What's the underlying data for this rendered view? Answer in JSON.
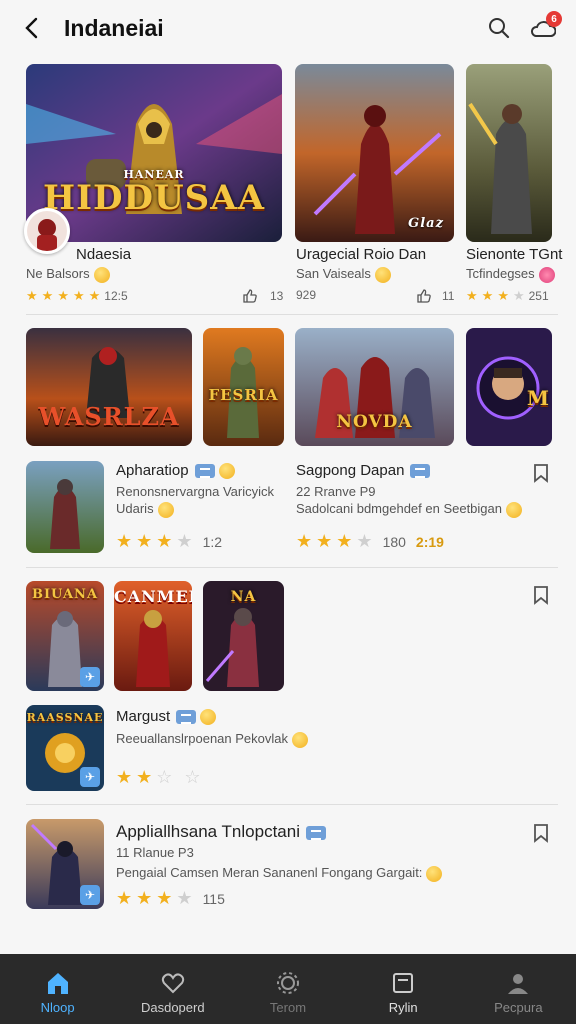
{
  "header": {
    "title": "Indaneiai",
    "notification_count": "6"
  },
  "row1": [
    {
      "art_title": "HIDDUSAA",
      "art_kicker": "HANEAR",
      "name": "Ndaesia",
      "sub": "Ne Balsors",
      "rating": 5,
      "score": "12:5",
      "likes": "13"
    },
    {
      "art_title": "Glaz",
      "name": "Uragecial Roio Dan",
      "sub": "San Vaiseals",
      "score": "929",
      "likes": "11"
    },
    {
      "name": "Sienonte TGnt",
      "sub": "Tcfindegses",
      "rating": 3,
      "score": "251"
    }
  ],
  "row2_tiles": [
    {
      "art_title": "WASRLZA"
    },
    {
      "art_title": "FESRIA"
    },
    {
      "art_title": "NOVDA"
    },
    {
      "art_title": "M"
    }
  ],
  "row2_items": [
    {
      "name": "Apharatiop",
      "line1": "Renonsnervargna Varicyick",
      "line2": "Udaris",
      "rating": 3,
      "score": "1:2"
    },
    {
      "name": "Sagpong Dapan",
      "line1": "22 Rranve P9",
      "line2": "Sadolcani bdmgehdef en Seetbigan",
      "rating": 3,
      "score": "180",
      "score2": "2:19"
    }
  ],
  "row3_tiles": [
    {
      "art_title": "BIUANA"
    },
    {
      "art_title": "CANMEE"
    },
    {
      "art_title": "NA"
    }
  ],
  "row3_item": {
    "art_title": "RAASSNAE",
    "name": "Margust",
    "line1": "Reeuallanslrpoenan Pekovlak",
    "rating": 2
  },
  "row4_item": {
    "name": "Appliallhsana Tnlopctani",
    "line1": "11 Rlanue P3",
    "line2": "Pengaial Camsen Meran Sananenl Fongang Gargait:",
    "rating": 3,
    "score": "115"
  },
  "nav": [
    {
      "label": "Nloop",
      "active": true
    },
    {
      "label": "Dasdoperd"
    },
    {
      "label": "Terom"
    },
    {
      "label": "Rylin"
    },
    {
      "label": "Pecpura"
    }
  ],
  "colors": {
    "accent": "#4fb3ff",
    "star": "#f2b01e",
    "nav_bg": "#2a2a2a"
  }
}
